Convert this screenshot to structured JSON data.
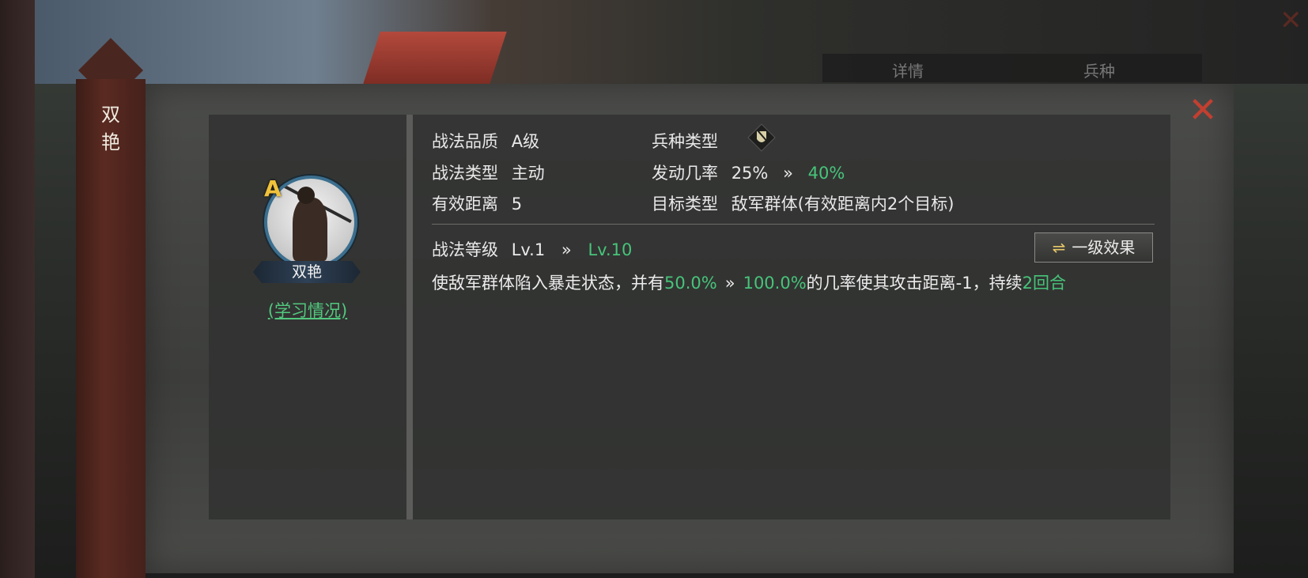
{
  "side_title": "双艳",
  "skill": {
    "name": "双艳",
    "grade": "A",
    "study_link": "(学习情况)"
  },
  "info": {
    "quality_label": "战法品质",
    "quality_value": "A级",
    "type_label": "战法类型",
    "type_value": "主动",
    "range_label": "有效距离",
    "range_value": "5",
    "troop_label": "兵种类型",
    "troop_icon": "cavalry-shield-icon",
    "rate_label": "发动几率",
    "rate_from": "25%",
    "rate_to": "40%",
    "target_label": "目标类型",
    "target_value": "敌军群体(有效距离内2个目标)",
    "level_label": "战法等级",
    "level_from": "Lv.1",
    "level_to": "Lv.10"
  },
  "arrow": "»",
  "effect_button": {
    "icon": "⇌",
    "label": "一级效果"
  },
  "description": {
    "part1": "使敌军群体陷入暴走状态，并有",
    "chance_from": "50.0%",
    "chance_to": "100.0%",
    "part2": "的几率使其攻击距离-1，持续",
    "duration": "2回合"
  },
  "background": {
    "tab1": "详情",
    "tab2": "兵种"
  },
  "colors": {
    "accent_green": "#47c47a",
    "close_red": "#c23f30",
    "grade_gold": "#f0c23a"
  }
}
